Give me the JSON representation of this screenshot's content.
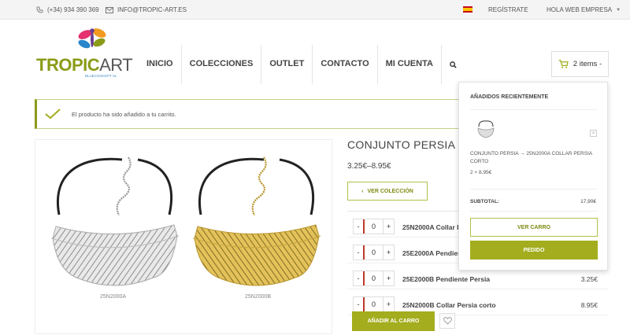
{
  "topbar": {
    "phone": "(+34) 934 390 369",
    "email": "INFO@TROPIC-ART.ES",
    "register": "REGÍSTRATE",
    "account": "HOLA WEB EMPRESA"
  },
  "logo": {
    "tropic": "TROPIC",
    "art": "ART",
    "sub": "BLUECONCEPT SL"
  },
  "nav": {
    "items": [
      "INICIO",
      "COLECCIONES",
      "OUTLET",
      "CONTACTO",
      "MI CUENTA"
    ]
  },
  "cart": {
    "label": "2 items -"
  },
  "notice": {
    "text": "El producto ha sido añadido a tu carrito."
  },
  "gallery": {
    "captions": [
      "25N2000A",
      "25N2000B"
    ]
  },
  "product": {
    "title": "CONJUNTO PERSIA",
    "price_range": "3.25€–8.95€",
    "view_collection": "VER COLECCIÓN",
    "variants": [
      {
        "qty": "0",
        "name": "25N2000A Collar Persia Corto",
        "price": ""
      },
      {
        "qty": "0",
        "name": "25E2000A Pendiente Persia",
        "price": ""
      },
      {
        "qty": "0",
        "name": "25E2000B Pendiente Persia",
        "price": "3.25€"
      },
      {
        "qty": "0",
        "name": "25N2000B Collar Persia corto",
        "price": "8.95€"
      }
    ],
    "add_to_cart": "AÑADIR AL CARRO"
  },
  "minicart": {
    "title": "AÑADIDOS RECIENTEMENTE",
    "item_name": "CONJUNTO PERSIA → 25N2000A COLLAR PERSIA CORTO",
    "item_qty": "2 × 8,95€",
    "subtotal_label": "SUBTOTAL:",
    "subtotal_value": "17,90€",
    "view_cart": "VER CARRO",
    "order": "PEDIDO"
  },
  "colors": {
    "accent": "#a3ad1d",
    "accent_dark": "#8b9b18"
  }
}
